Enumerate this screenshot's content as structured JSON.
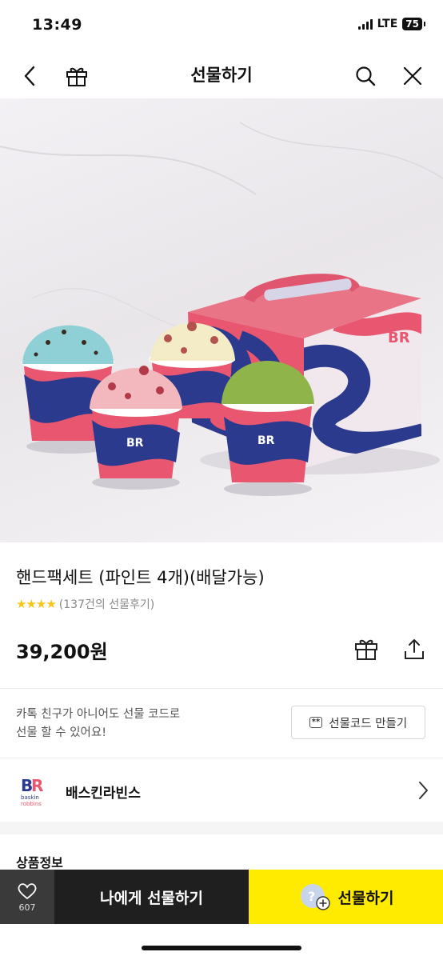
{
  "status": {
    "time": "13:49",
    "network": "LTE",
    "battery": "75"
  },
  "header": {
    "title": "선물하기"
  },
  "product": {
    "title": "핸드팩세트 (파인트 4개)(배달가능)",
    "rating_stars": "★★★★",
    "review_text": "(137건의 선물후기)",
    "price": "39,200원"
  },
  "gift_code": {
    "line1": "카톡 친구가 아니어도 선물 코드로",
    "line2": "선물 할 수 있어요!",
    "chip": "**",
    "button_label": "선물코드 만들기"
  },
  "brand": {
    "name": "배스킨라빈스"
  },
  "section": {
    "title": "상품정보"
  },
  "bottom_bar": {
    "like_count": "607",
    "self_gift_label": "나에게 선물하기",
    "gift_label": "선물하기"
  },
  "colors": {
    "kakao_yellow": "#ffeb00",
    "br_pink": "#e8566f",
    "br_blue": "#2b3a8c"
  },
  "icons": [
    "back-icon",
    "gift-icon",
    "search-icon",
    "close-icon",
    "gift-box-icon",
    "share-icon",
    "chevron-right-icon",
    "heart-icon",
    "gift-bubble-icon"
  ]
}
